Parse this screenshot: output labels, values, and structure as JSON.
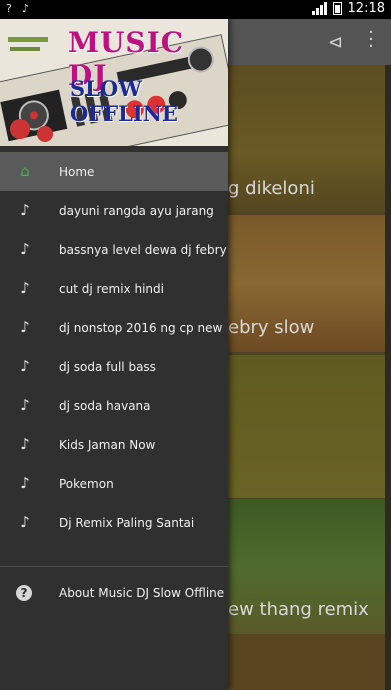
{
  "status_bar": {
    "left_icons": [
      "wifi-question-icon",
      "music-note-icon"
    ],
    "time": "12:18"
  },
  "app": {
    "toolbar": {
      "icons": [
        "share-icon",
        "overflow-menu-icon"
      ]
    },
    "cards": [
      {
        "title": "g dikeloni"
      },
      {
        "title": "ebry slow"
      },
      {
        "title": ""
      },
      {
        "title": "ew thang remix"
      },
      {
        "title": ""
      }
    ]
  },
  "drawer": {
    "header": {
      "logo_line1": "MUSIC DJ",
      "logo_line2": "SLOW OFFLINE"
    },
    "items": [
      {
        "label": "Home",
        "icon": "home-icon",
        "active": true
      },
      {
        "label": "dayuni rangda ayu jarang",
        "icon": "music-note-icon"
      },
      {
        "label": "bassnya level dewa dj febry",
        "icon": "music-note-icon"
      },
      {
        "label": "cut dj remix hindi",
        "icon": "music-note-icon"
      },
      {
        "label": "dj nonstop 2016 ng cp new",
        "icon": "music-note-icon"
      },
      {
        "label": "dj soda full bass",
        "icon": "music-note-icon"
      },
      {
        "label": "dj soda havana",
        "icon": "music-note-icon"
      },
      {
        "label": "Kids Jaman Now",
        "icon": "music-note-icon"
      },
      {
        "label": "Pokemon",
        "icon": "music-note-icon"
      },
      {
        "label": "Dj Remix Paling Santai",
        "icon": "music-note-icon"
      }
    ],
    "about": {
      "label": "About Music DJ Slow Offline",
      "icon": "help-icon"
    }
  },
  "colors": {
    "active_icon": "#4caf50",
    "drawer_bg": "#303030",
    "active_row": "#5a5a5a"
  }
}
